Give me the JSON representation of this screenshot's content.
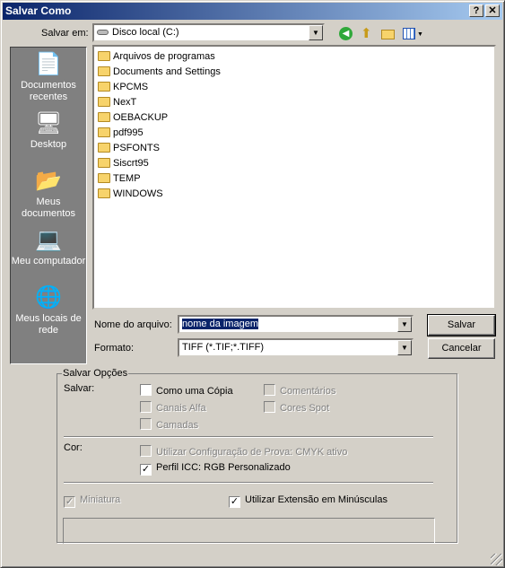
{
  "window": {
    "title": "Salvar Como",
    "help": "?",
    "close": "✕"
  },
  "toolbar": {
    "save_in_label": "Salvar em:",
    "save_in_value": "Disco local (C:)",
    "icons": [
      "back-icon",
      "up-folder-icon",
      "new-folder-icon",
      "view-menu-icon"
    ]
  },
  "places": [
    {
      "label": "Documentos recentes",
      "icon": "recent-documents-icon"
    },
    {
      "label": "Desktop",
      "icon": "desktop-icon"
    },
    {
      "label": "Meus documentos",
      "icon": "my-documents-icon"
    },
    {
      "label": "Meu computador",
      "icon": "my-computer-icon"
    },
    {
      "label": "Meus locais de rede",
      "icon": "network-places-icon"
    }
  ],
  "files": [
    "Arquivos de programas",
    "Documents and Settings",
    "KPCMS",
    "NexT",
    "OEBACKUP",
    "pdf995",
    "PSFONTS",
    "Siscrt95",
    "TEMP",
    "WINDOWS"
  ],
  "filename": {
    "label": "Nome do arquivo:",
    "value": "nome da imagem"
  },
  "format": {
    "label": "Formato:",
    "value": "TIFF (*.TIF;*.TIFF)"
  },
  "buttons": {
    "save": "Salvar",
    "cancel": "Cancelar"
  },
  "options": {
    "group_title": "Salvar Opções",
    "save_label": "Salvar:",
    "as_copy": {
      "label": "Como uma Cópia",
      "checked": false,
      "enabled": true
    },
    "comments": {
      "label": "Comentários",
      "checked": false,
      "enabled": false
    },
    "alpha": {
      "label": "Canais Alfa",
      "checked": false,
      "enabled": false
    },
    "spot": {
      "label": "Cores Spot",
      "checked": false,
      "enabled": false
    },
    "layers": {
      "label": "Camadas",
      "checked": false,
      "enabled": false
    },
    "color_label": "Cor:",
    "proof": {
      "label": "Utilizar Configuração de Prova: CMYK ativo",
      "checked": false,
      "enabled": false
    },
    "icc": {
      "label": "Perfil ICC: RGB Personalizado",
      "checked": true,
      "enabled": true
    },
    "thumbnail": {
      "label": "Miniatura",
      "checked": true,
      "enabled": false
    },
    "lowercase": {
      "label": "Utilizar Extensão em Minúsculas",
      "checked": true,
      "enabled": true
    }
  }
}
